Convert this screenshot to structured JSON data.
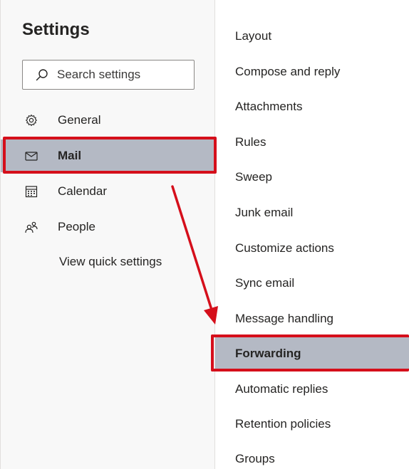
{
  "settings": {
    "title": "Settings",
    "search_placeholder": "Search settings"
  },
  "nav": {
    "items": [
      {
        "label": "General",
        "icon": "gear-icon"
      },
      {
        "label": "Mail",
        "icon": "mail-icon",
        "selected": true
      },
      {
        "label": "Calendar",
        "icon": "calendar-icon"
      },
      {
        "label": "People",
        "icon": "people-icon"
      }
    ],
    "quick_settings_label": "View quick settings"
  },
  "mail_settings": {
    "items": [
      "Layout",
      "Compose and reply",
      "Attachments",
      "Rules",
      "Sweep",
      "Junk email",
      "Customize actions",
      "Sync email",
      "Message handling",
      "Forwarding",
      "Automatic replies",
      "Retention policies",
      "Groups"
    ],
    "selected": "Forwarding"
  },
  "colors": {
    "selection": "#b4b9c4",
    "annotation": "#d50f1b"
  }
}
